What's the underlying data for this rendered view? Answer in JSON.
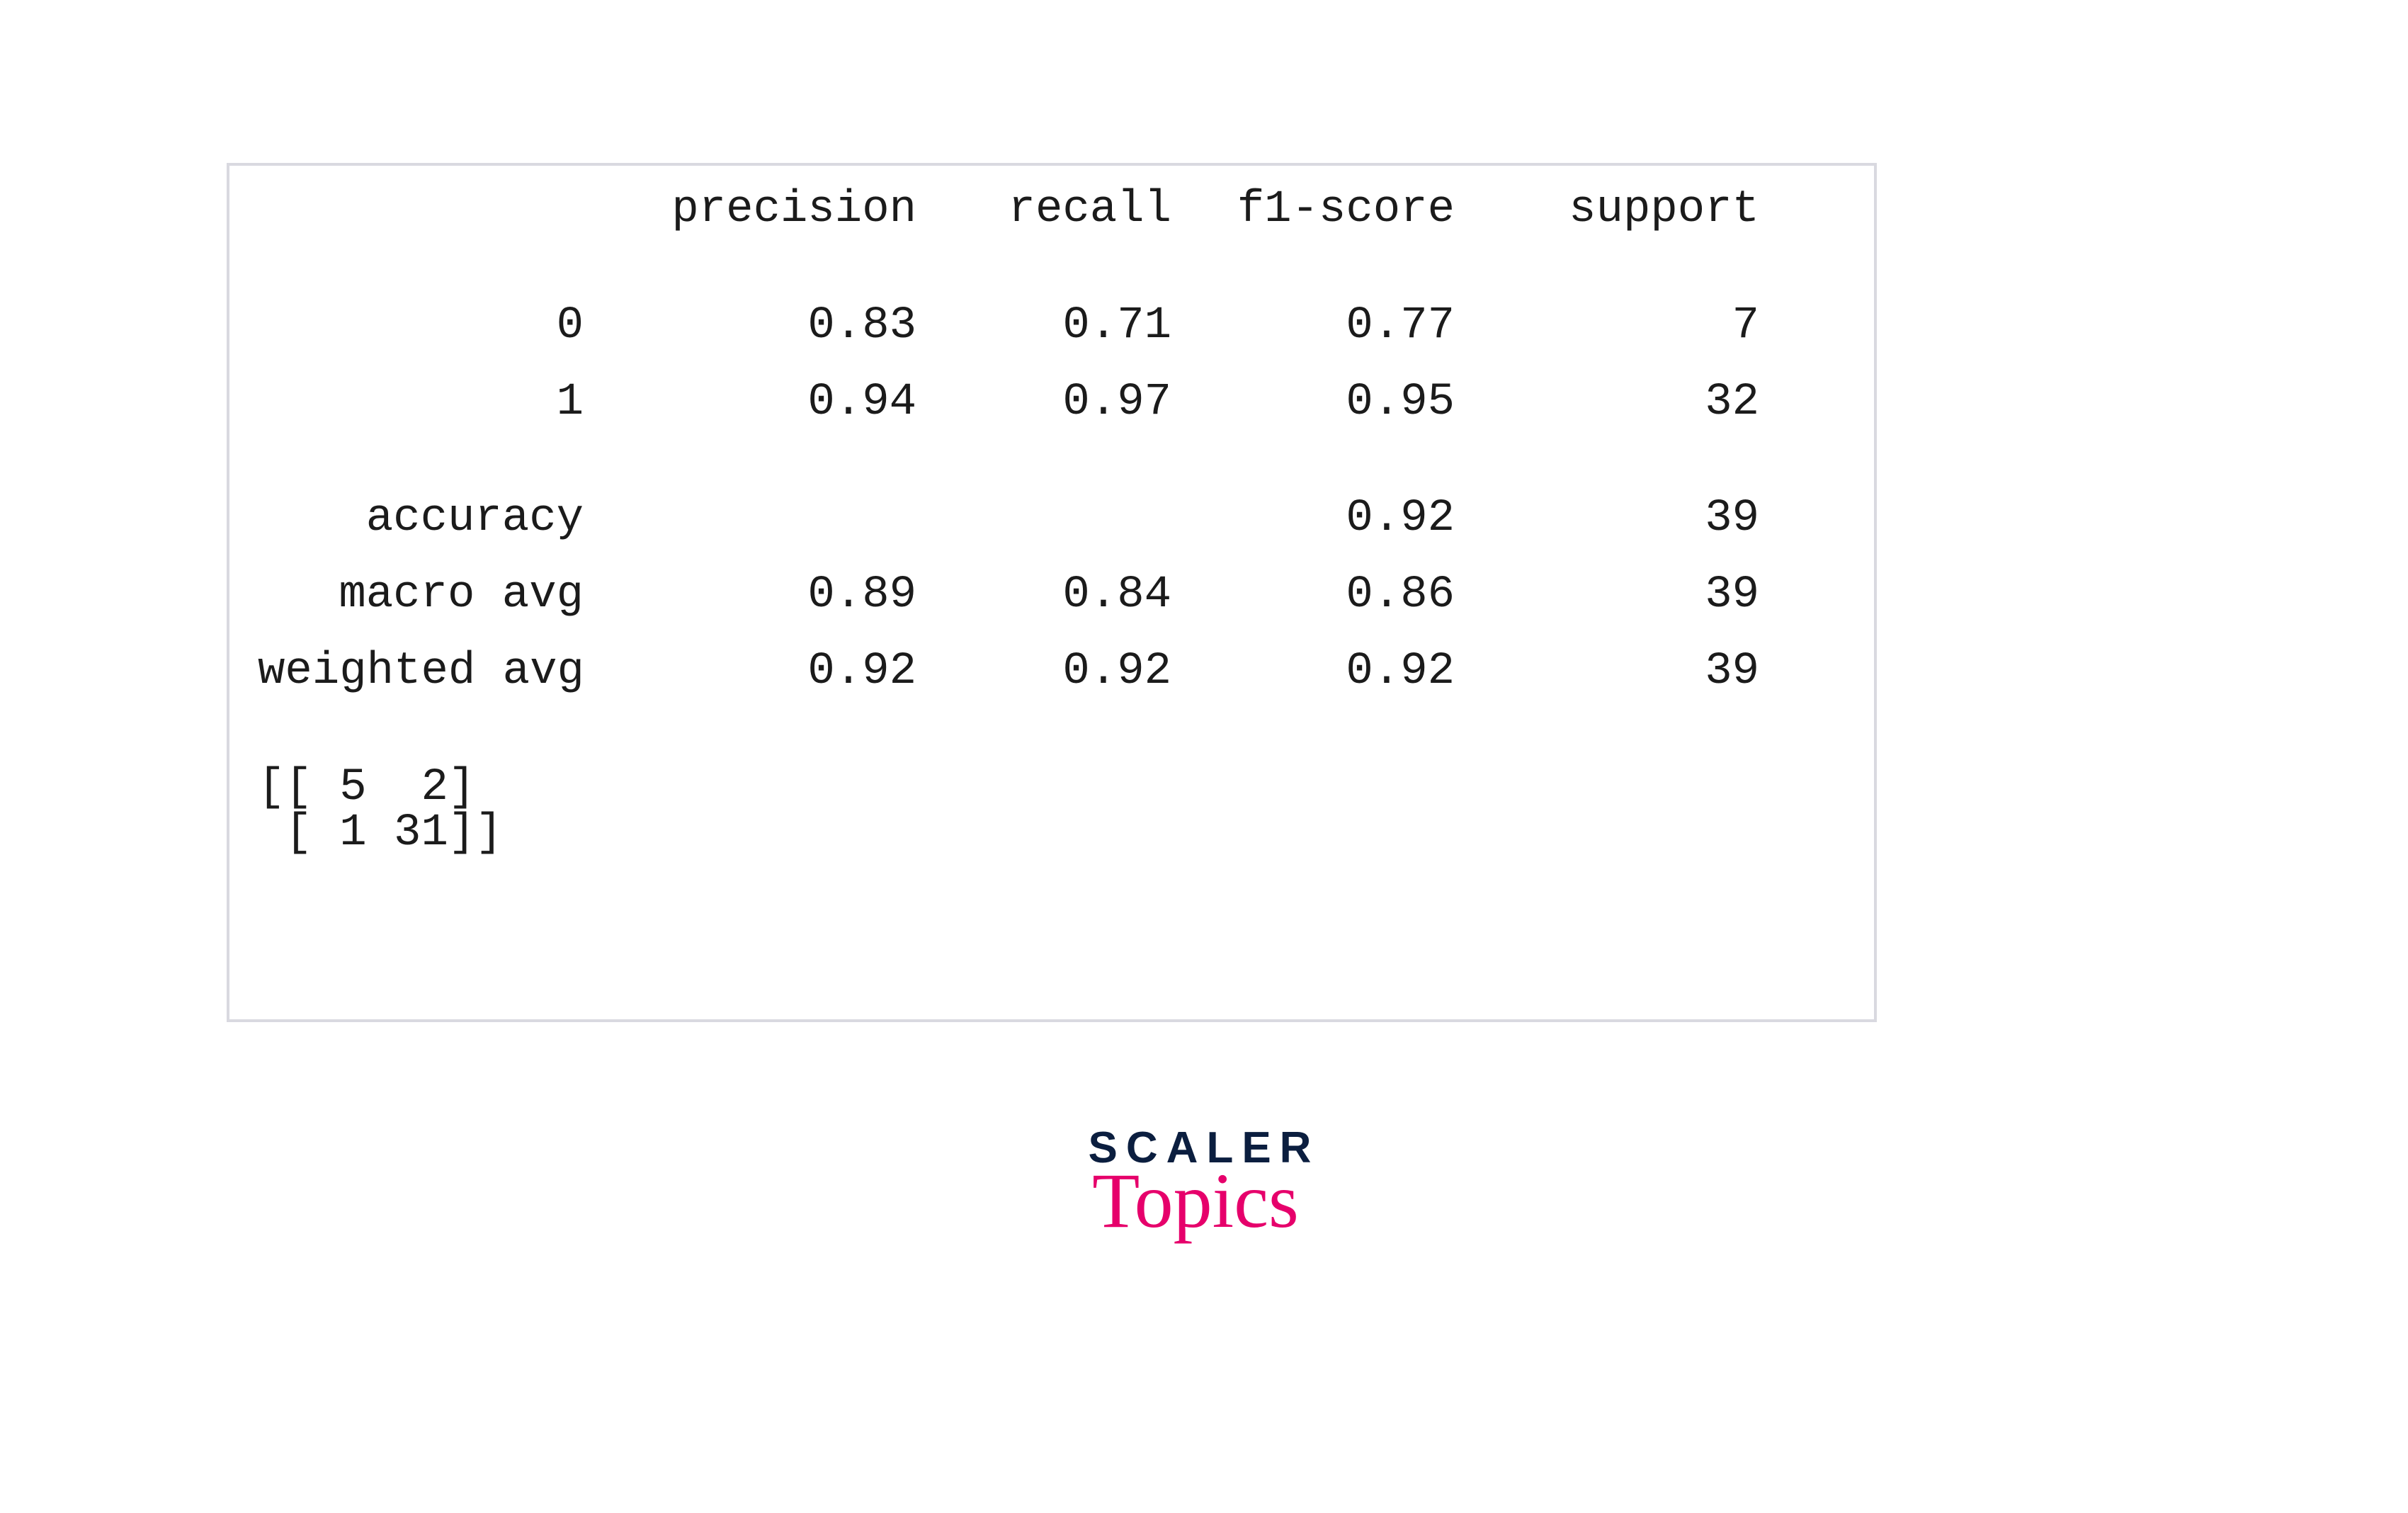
{
  "chart_data": {
    "type": "table",
    "title": "classification report + confusion matrix",
    "columns": [
      "precision",
      "recall",
      "f1-score",
      "support"
    ],
    "rows": [
      {
        "label": "0",
        "precision": 0.83,
        "recall": 0.71,
        "f1": 0.77,
        "support": 7
      },
      {
        "label": "1",
        "precision": 0.94,
        "recall": 0.97,
        "f1": 0.95,
        "support": 32
      },
      {
        "label": "accuracy",
        "precision": null,
        "recall": null,
        "f1": 0.92,
        "support": 39
      },
      {
        "label": "macro avg",
        "precision": 0.89,
        "recall": 0.84,
        "f1": 0.86,
        "support": 39
      },
      {
        "label": "weighted avg",
        "precision": 0.92,
        "recall": 0.92,
        "f1": 0.92,
        "support": 39
      }
    ],
    "confusion_matrix": [
      [
        5,
        2
      ],
      [
        1,
        31
      ]
    ]
  },
  "hdr": {
    "precision": "precision",
    "recall": "recall",
    "f1": "f1-score",
    "support": "support"
  },
  "r0": {
    "label": "0",
    "precision": "0.83",
    "recall": "0.71",
    "f1": "0.77",
    "support": "7"
  },
  "r1": {
    "label": "1",
    "precision": "0.94",
    "recall": "0.97",
    "f1": "0.95",
    "support": "32"
  },
  "acc": {
    "label": "accuracy",
    "precision": "",
    "recall": "",
    "f1": "0.92",
    "support": "39"
  },
  "mac": {
    "label": "macro avg",
    "precision": "0.89",
    "recall": "0.84",
    "f1": "0.86",
    "support": "39"
  },
  "wtd": {
    "label": "weighted avg",
    "precision": "0.92",
    "recall": "0.92",
    "f1": "0.92",
    "support": "39"
  },
  "cm": {
    "row1": "[[ 5  2]",
    "row2": " [ 1 31]]"
  },
  "logo": {
    "top": "SCALER",
    "bottom": "Topics"
  }
}
